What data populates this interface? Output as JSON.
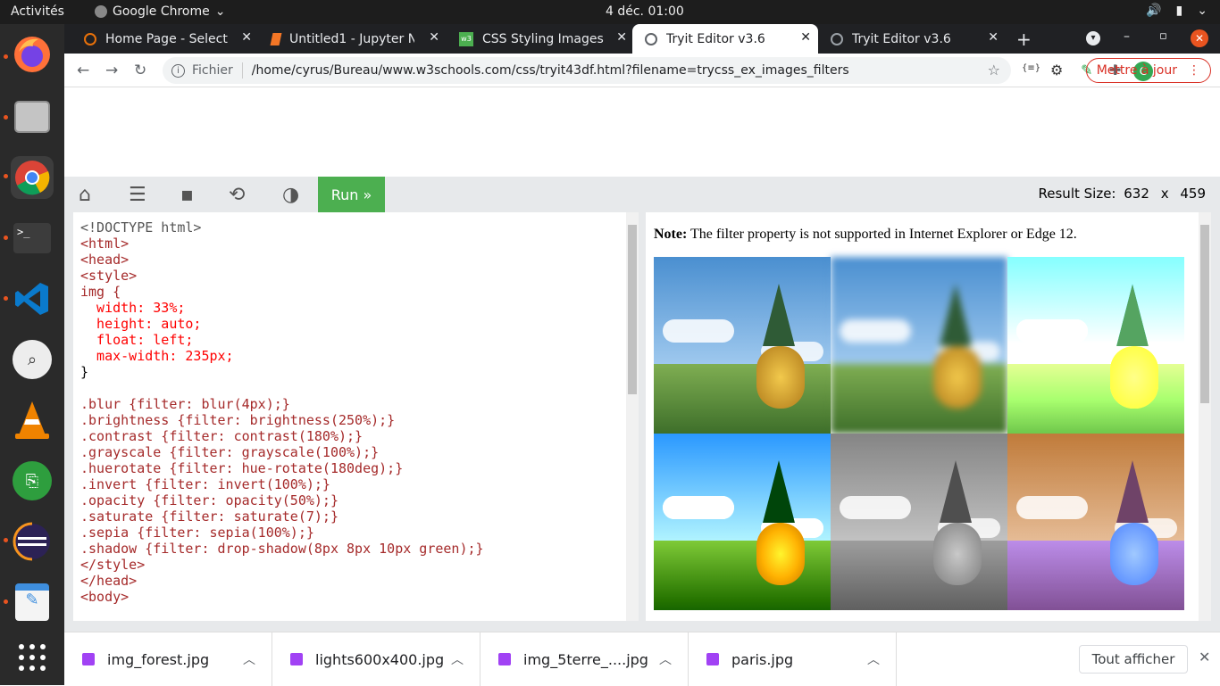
{
  "system": {
    "activities": "Activités",
    "app_name": "Google Chrome",
    "clock": "4 déc.  01:00"
  },
  "tabs": [
    {
      "title": "Home Page - Select or",
      "favicon": "circle-icon",
      "active": false
    },
    {
      "title": "Untitled1 - Jupyter No",
      "favicon": "jupyter-icon",
      "active": false
    },
    {
      "title": "CSS Styling Images",
      "favicon": "w3-icon",
      "active": false
    },
    {
      "title": "Tryit Editor v3.6",
      "favicon": "globe-icon",
      "active": true
    },
    {
      "title": "Tryit Editor v3.6",
      "favicon": "globe-icon",
      "active": false
    }
  ],
  "omnibar": {
    "scheme_label": "Fichier",
    "url": "/home/cyrus/Bureau/www.w3schools.com/css/tryit43df.html?filename=trycss_ex_images_filters",
    "update_label": "Mettre à jour",
    "avatar_letter": "C"
  },
  "toolbar": {
    "run_label": "Run »",
    "result_size_label": "Result Size:",
    "result_w": "632",
    "result_x": "x",
    "result_h": "459"
  },
  "code_lines": [
    "<!DOCTYPE html>",
    "<html>",
    "<head>",
    "<style>",
    "img {",
    "  width: 33%;",
    "  height: auto;",
    "  float: left;",
    "  max-width: 235px;",
    "}",
    "",
    ".blur {filter: blur(4px);}",
    ".brightness {filter: brightness(250%);}",
    ".contrast {filter: contrast(180%);}",
    ".grayscale {filter: grayscale(100%);}",
    ".huerotate {filter: hue-rotate(180deg);}",
    ".invert {filter: invert(100%);}",
    ".opacity {filter: opacity(50%);}",
    ".saturate {filter: saturate(7);}",
    ".sepia {filter: sepia(100%);}",
    ".shadow {filter: drop-shadow(8px 8px 10px green);}",
    "</style>",
    "</head>",
    "<body>"
  ],
  "result": {
    "note_bold": "Note:",
    "note_text": " The filter property is not supported in Internet Explorer or Edge 12."
  },
  "downloads": [
    {
      "name": "img_forest.jpg"
    },
    {
      "name": "lights600x400.jpg"
    },
    {
      "name": "img_5terre_....jpg"
    },
    {
      "name": "paris.jpg"
    }
  ],
  "downloads_show_all": "Tout afficher"
}
